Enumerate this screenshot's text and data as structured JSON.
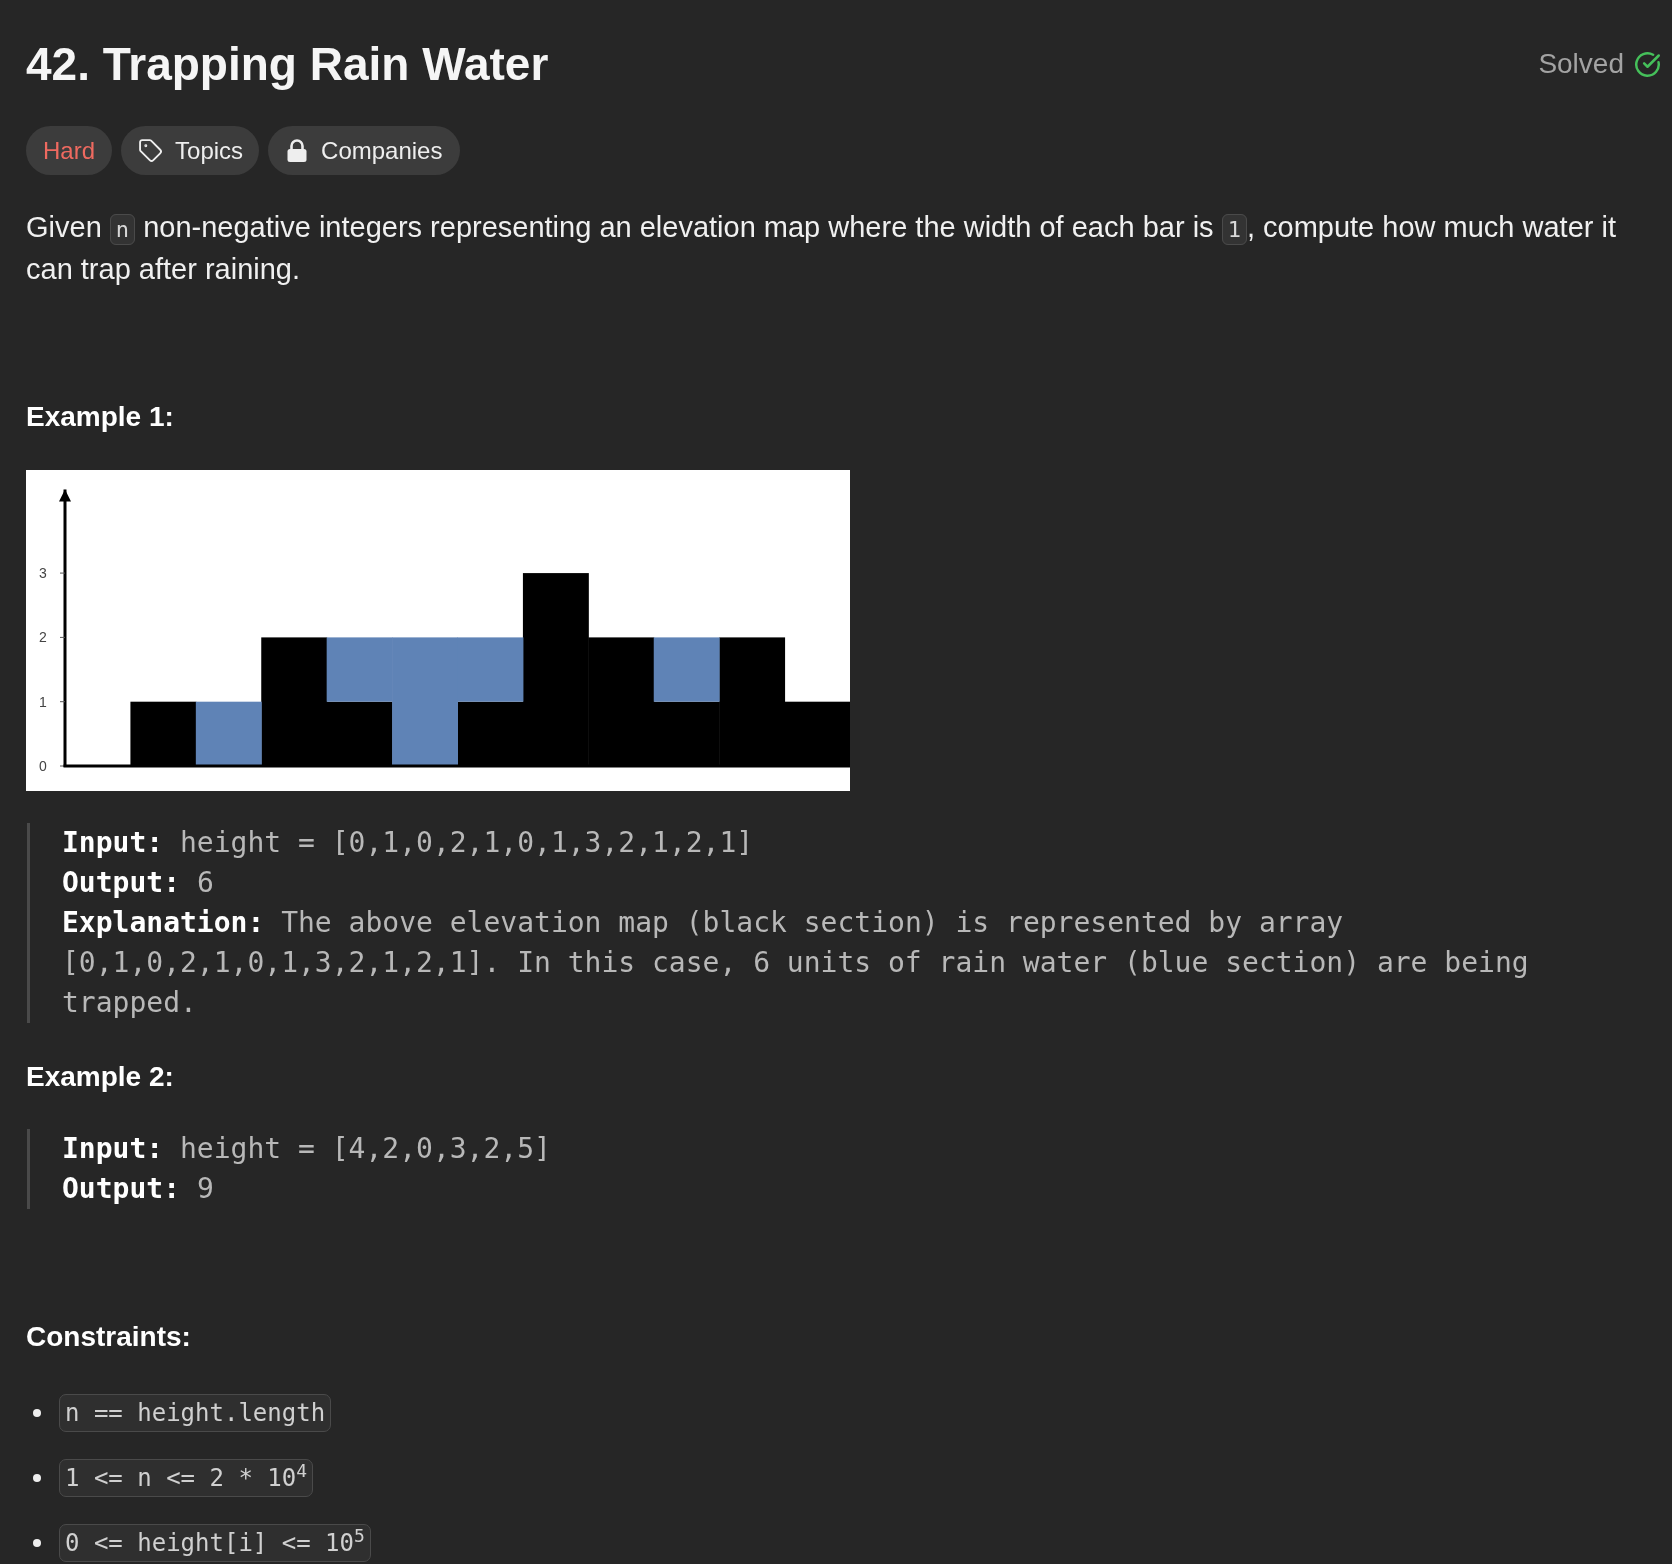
{
  "problem": {
    "title": "42. Trapping Rain Water",
    "status": {
      "label": "Solved"
    }
  },
  "tags": [
    {
      "kind": "difficulty",
      "label": "Hard"
    },
    {
      "kind": "topics",
      "label": "Topics"
    },
    {
      "kind": "companies",
      "label": "Companies"
    }
  ],
  "description": [
    {
      "kind": "text",
      "text": "Given "
    },
    {
      "kind": "code",
      "text": "n"
    },
    {
      "kind": "text",
      "text": " non-negative integers representing an elevation map where the width of each bar is "
    },
    {
      "kind": "code",
      "text": "1"
    },
    {
      "kind": "text",
      "text": ", compute how much water it can trap after raining."
    }
  ],
  "examples": [
    {
      "heading": "Example 1:",
      "figure": {
        "chart_data": {
          "type": "bar",
          "stacked": true,
          "ylim": [
            0,
            4.3
          ],
          "yticks": [
            0,
            1,
            2,
            3
          ],
          "series": [
            {
              "color": "#000000",
              "values": [
                0,
                1,
                0,
                2,
                1,
                0,
                1,
                3,
                2,
                1,
                2,
                1
              ]
            },
            {
              "color": "#5f83b6",
              "values": [
                0,
                0,
                1,
                0,
                1,
                2,
                1,
                0,
                0,
                1,
                0,
                0
              ]
            }
          ]
        }
      },
      "lines": [
        {
          "label": "Input:",
          "value": "height = [0,1,0,2,1,0,1,3,2,1,2,1]"
        },
        {
          "label": "Output:",
          "value": "6"
        },
        {
          "label": "Explanation:",
          "value": "The above elevation map (black section) is represented by array [0,1,0,2,1,0,1,3,2,1,2,1]. In this case, 6 units of rain water (blue section) are being trapped."
        }
      ]
    },
    {
      "heading": "Example 2:",
      "lines": [
        {
          "label": "Input:",
          "value": "height = [4,2,0,3,2,5]"
        },
        {
          "label": "Output:",
          "value": "9"
        }
      ]
    }
  ],
  "constraints": {
    "heading": "Constraints:",
    "items": [
      "n == height.length",
      "1 <= n <= 2 * 10$^{4}$",
      "0 <= height[i] <= 10$^{5}$"
    ]
  }
}
